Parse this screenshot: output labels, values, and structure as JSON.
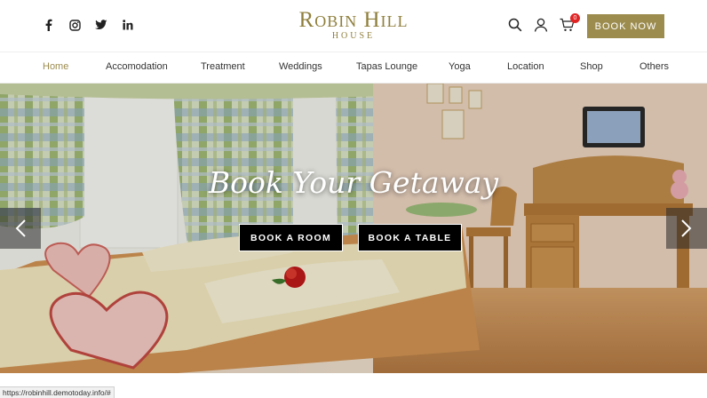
{
  "header": {
    "logo_line1": "Robin Hill",
    "logo_line2": "HOUSE",
    "social": [
      {
        "name": "facebook-icon",
        "glyph": "f"
      },
      {
        "name": "instagram-icon",
        "glyph": "◎"
      },
      {
        "name": "twitter-icon",
        "glyph": "🐦"
      },
      {
        "name": "linkedin-icon",
        "glyph": "in"
      }
    ],
    "cart_count": "0",
    "book_now_label": "BOOK NOW",
    "brand_color": "#9c8c4e"
  },
  "nav": {
    "items": [
      "Home",
      "Accomodation",
      "Treatment",
      "Weddings",
      "Tapas Lounge",
      "Yoga",
      "Location",
      "Shop",
      "Others"
    ],
    "active": "Home"
  },
  "hero": {
    "headline": "Book Your Getaway",
    "button_room": "BOOK A ROOM",
    "button_table": "BOOK A TABLE"
  },
  "status_bar": {
    "url": "https://robinhill.demotoday.info/#"
  }
}
